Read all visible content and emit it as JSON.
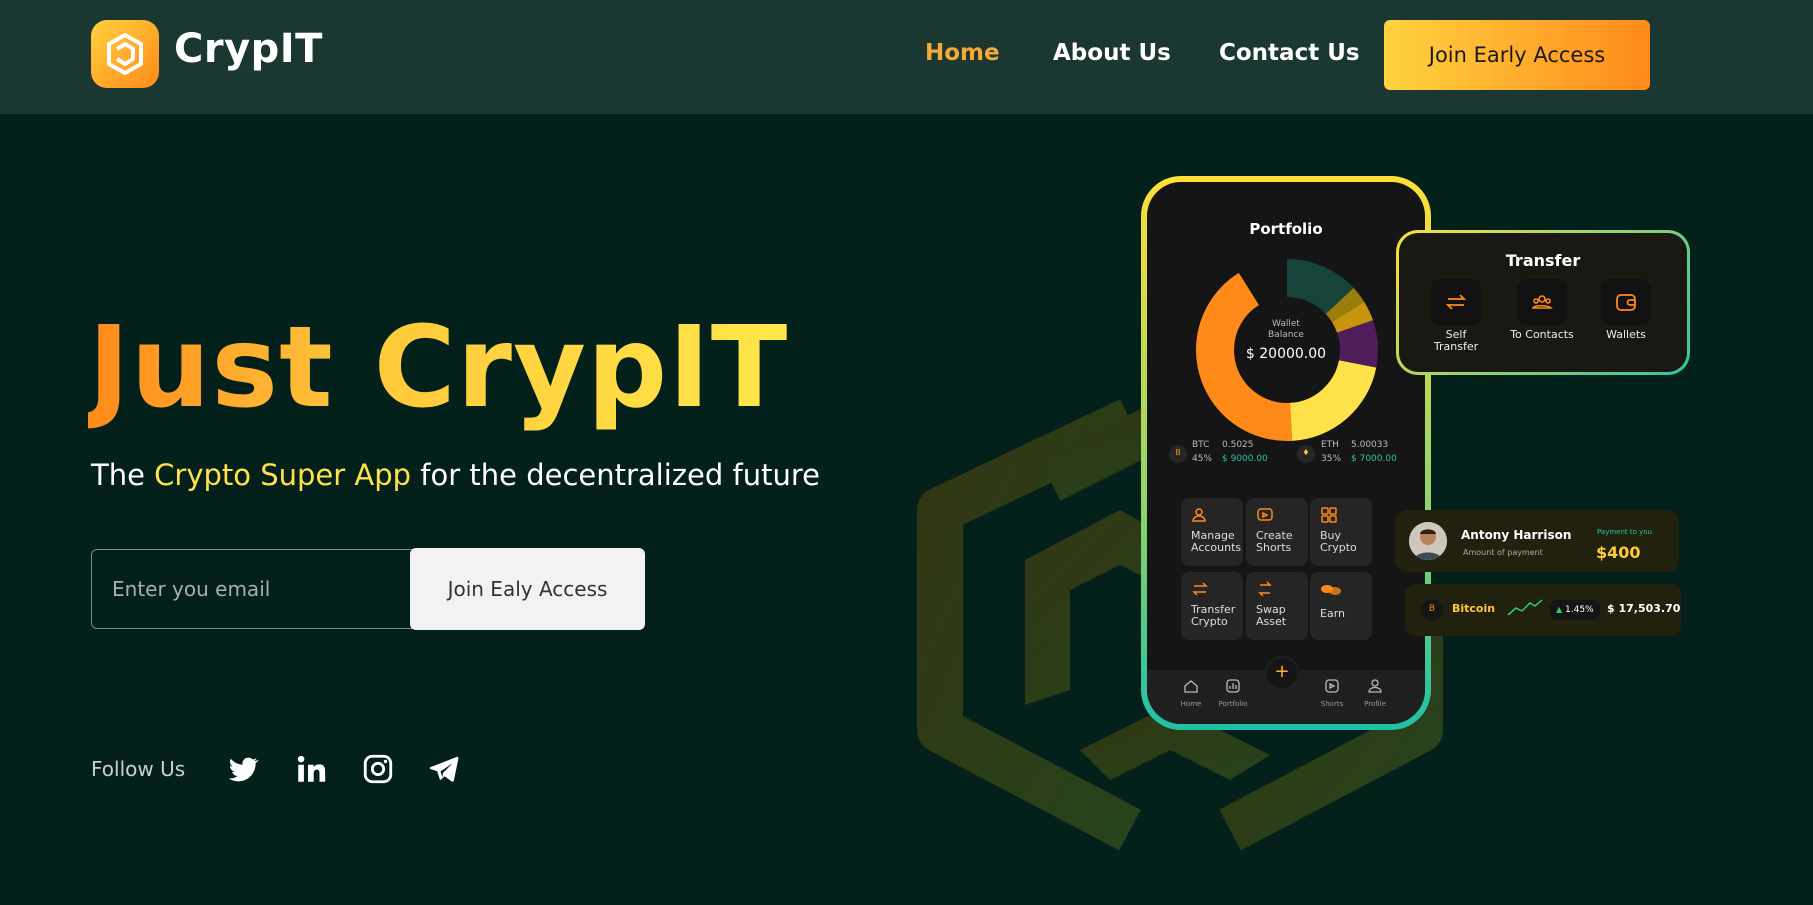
{
  "header": {
    "brand": "CrypIT",
    "nav": [
      "Home",
      "About Us",
      "Contact Us"
    ],
    "active_nav": "Home",
    "cta_label": "Join Early Access"
  },
  "hero": {
    "title_word1": "Just",
    "title_word2": "CrypIT",
    "subtitle_pre": "The ",
    "subtitle_highlight": "Crypto Super App",
    "subtitle_post": " for the decentralized future",
    "email_placeholder": "Enter you email",
    "email_button": "Join Ealy Access"
  },
  "social": {
    "label": "Follow Us",
    "icons": [
      "twitter-icon",
      "linkedin-icon",
      "instagram-icon",
      "telegram-icon"
    ]
  },
  "phone": {
    "title": "Portfolio",
    "wallet_label_1": "Wallet",
    "wallet_label_2": "Balance",
    "wallet_value": "$ 20000.00",
    "assets": [
      {
        "icon": "B",
        "symbol": "BTC",
        "amount": "0.5025",
        "percent": "45%",
        "value": "$ 9000.00"
      },
      {
        "icon": "♦",
        "symbol": "ETH",
        "amount": "5.00033",
        "percent": "35%",
        "value": "$ 7000.00"
      }
    ],
    "actions": [
      [
        "Manage",
        "Accounts"
      ],
      [
        "Create",
        "Shorts"
      ],
      [
        "Buy",
        "Crypto"
      ],
      [
        "Transfer",
        "Crypto"
      ],
      [
        "Swap",
        "Asset"
      ],
      [
        "Earn",
        ""
      ]
    ],
    "tabs": [
      "Home",
      "Portfolio",
      "Shorts",
      "Profile"
    ],
    "fab": "+"
  },
  "transfer": {
    "title": "Transfer",
    "items": [
      [
        "Self",
        "Transfer"
      ],
      [
        "To Contacts",
        ""
      ],
      [
        "Wallets",
        ""
      ]
    ]
  },
  "payment": {
    "name": "Antony Harrison",
    "sub": "Amount of payment",
    "label": "Payment to you",
    "amount": "$400"
  },
  "ticker": {
    "icon": "B",
    "name": "Bitcoin",
    "change": "1.45%",
    "price": "$ 17,503.70"
  },
  "colors": {
    "bg": "#03201b",
    "header_bg": "#1b3732",
    "accent_orange": "#ff8a1a",
    "accent_yellow": "#ffd23f",
    "nav_active": "#f7a935",
    "teal": "#2ec3a3"
  }
}
